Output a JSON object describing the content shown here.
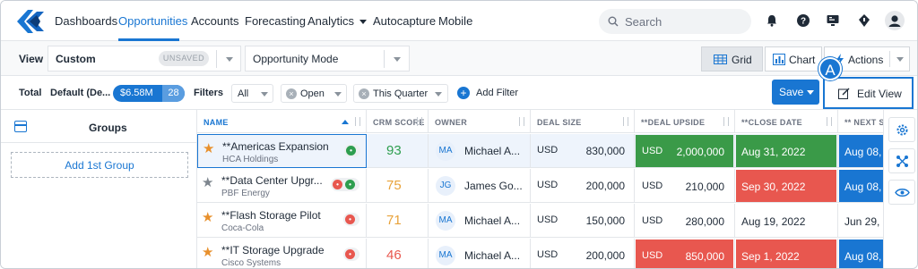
{
  "nav": {
    "items": [
      "Dashboards",
      "Opportunities",
      "Accounts",
      "Forecasting",
      "Analytics",
      "Autocapture",
      "Mobile"
    ],
    "active": "Opportunities",
    "search_placeholder": "Search"
  },
  "viewbar": {
    "view_label": "View",
    "view_value": "Custom",
    "unsaved_badge": "UNSAVED",
    "mode_value": "Opportunity Mode",
    "grid_label": "Grid",
    "chart_label": "Chart",
    "actions_label": "Actions"
  },
  "filterbar": {
    "total_label": "Total",
    "default_label": "Default (De...",
    "total_amount": "$6.58M",
    "total_count": "28",
    "filters_label": "Filters",
    "all_value": "All",
    "chips": [
      "Open",
      "This Quarter"
    ],
    "add_filter_label": "Add Filter",
    "save_label": "Save",
    "edit_view_label": "Edit View",
    "callout_badge": "A"
  },
  "groups": {
    "title": "Groups",
    "add_label": "Add 1st Group"
  },
  "grid": {
    "headers": {
      "name": "NAME",
      "crm": "CRM SCORE",
      "owner": "OWNER",
      "deal": "DEAL SIZE",
      "upside": "**DEAL UPSIDE",
      "close": "**CLOSE DATE",
      "next": "** NEXT S"
    },
    "rows": [
      {
        "name": "**Americas Expansion",
        "account": "HCA Holdings",
        "star": "orange",
        "score": "93",
        "score_color": "#2e9e4f",
        "initials": "MA",
        "owner": "Michael A...",
        "currency": "USD",
        "deal": "830,000",
        "upside_currency": "USD",
        "upside": "2,000,000",
        "upside_color": "#3a9a48",
        "close": "Aug 31, 2022",
        "close_color": "#3a9a48",
        "next": "Aug 08,",
        "next_color": "#1976d2"
      },
      {
        "name": "**Data Center Upgr...",
        "account": "PBF Energy",
        "star": "gray",
        "score": "75",
        "score_color": "#e8a23a",
        "initials": "JG",
        "owner": "James Go...",
        "currency": "USD",
        "deal": "200,000",
        "upside_currency": "USD",
        "upside": "210,000",
        "upside_color": "",
        "close": "Sep 30, 2022",
        "close_color": "#e8574f",
        "next": "Aug 08,",
        "next_color": "#1976d2"
      },
      {
        "name": "**Flash Storage Pilot",
        "account": "Coca-Cola",
        "star": "orange",
        "score": "71",
        "score_color": "#e8a23a",
        "initials": "MA",
        "owner": "Michael A...",
        "currency": "USD",
        "deal": "150,000",
        "upside_currency": "USD",
        "upside": "280,000",
        "upside_color": "",
        "close": "Aug 19, 2022",
        "close_color": "",
        "next": "Jun 29,",
        "next_color": ""
      },
      {
        "name": "**IT Storage Upgrade",
        "account": "Cisco Systems",
        "star": "orange",
        "score": "46",
        "score_color": "#e8574f",
        "initials": "MA",
        "owner": "Michael A...",
        "currency": "USD",
        "deal": "200,000",
        "upside_currency": "USD",
        "upside": "850,000",
        "upside_color": "#e8574f",
        "close": "Sep 1, 2022",
        "close_color": "#e8574f",
        "next": "Aug 08,",
        "next_color": "#1976d2"
      }
    ]
  },
  "colors": {
    "accent": "#1976d2",
    "green": "#3a9a48",
    "red": "#e8574f",
    "orange_star": "#e8902c",
    "gray_star": "#7d858e"
  },
  "icons": [
    "logo",
    "search-icon",
    "bell-icon",
    "help-icon",
    "monitor-icon",
    "lightbulb-icon",
    "user-avatar-icon",
    "grid-icon",
    "chart-icon",
    "actions-icon",
    "edit-icon",
    "plus-icon",
    "settings-icon",
    "network-icon",
    "eye-icon"
  ]
}
